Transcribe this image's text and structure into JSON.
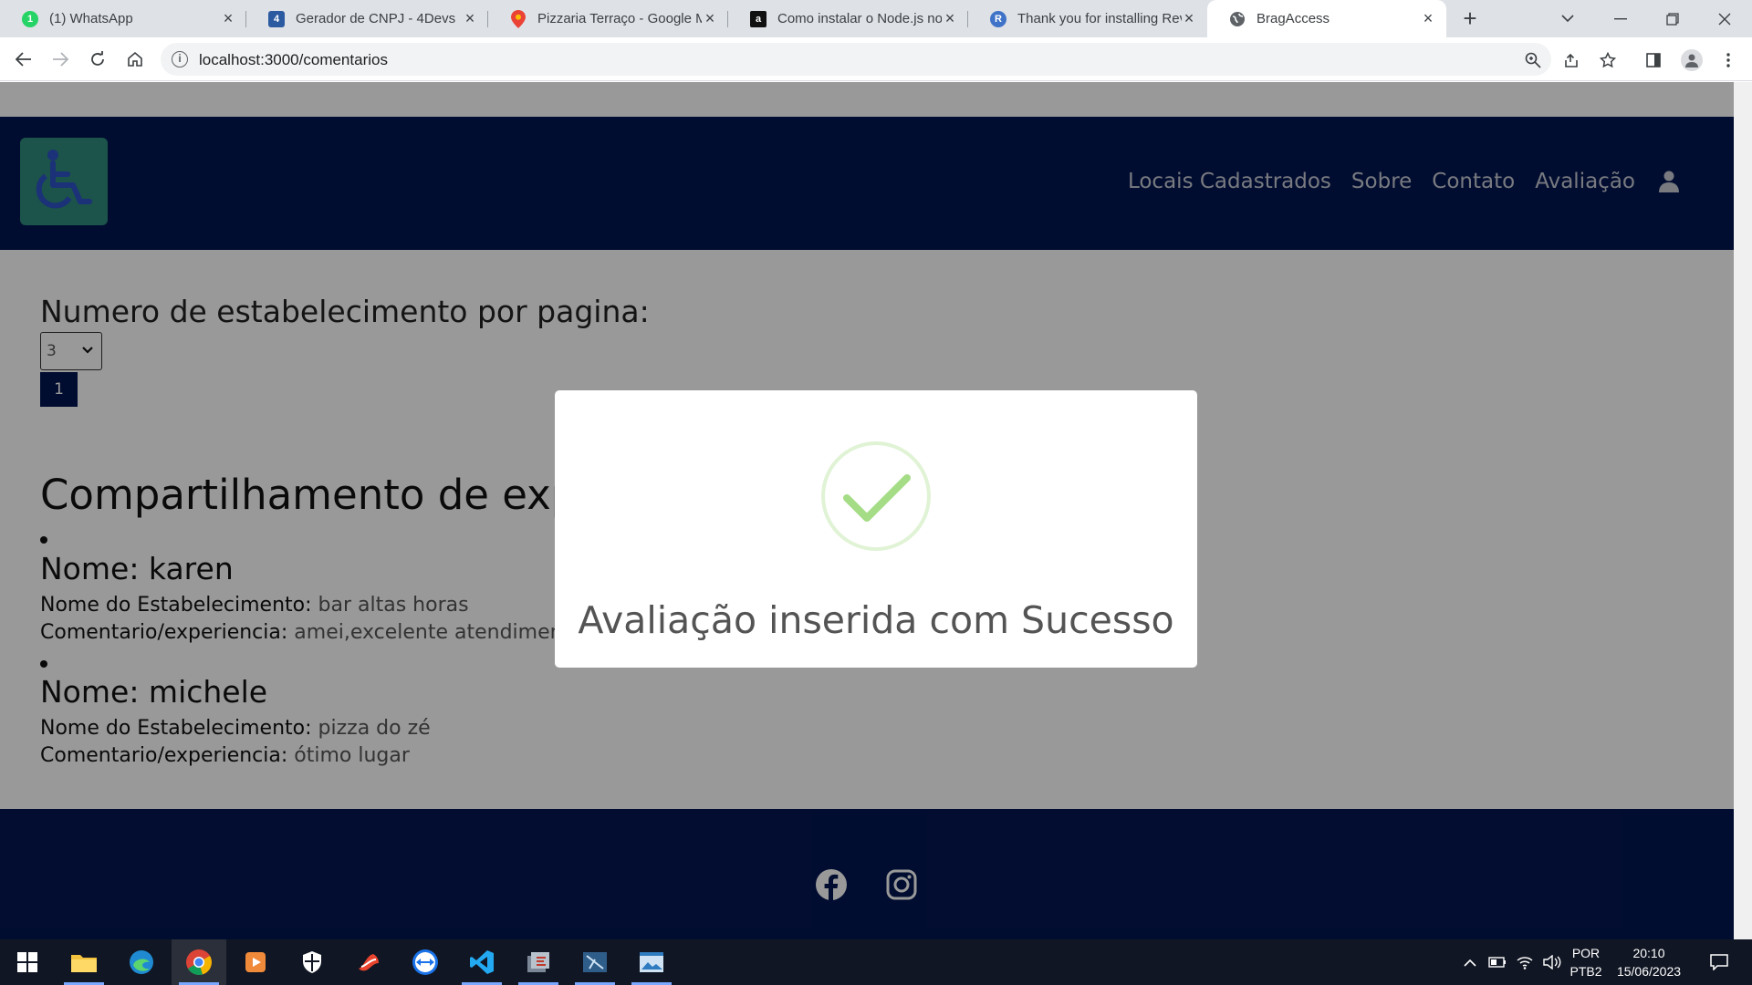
{
  "browser": {
    "tabs": [
      {
        "title": "(1) WhatsApp",
        "icon": "whatsapp-icon",
        "color": "#25d366"
      },
      {
        "title": "Gerador de CNPJ - 4Devs",
        "icon": "4devs-icon",
        "color": "#2c5aa0"
      },
      {
        "title": "Pizzaria Terraço - Google M",
        "icon": "google-maps-icon",
        "color": "#ea4335"
      },
      {
        "title": "Como instalar o Node.js no",
        "icon": "a-icon",
        "color": "#111111"
      },
      {
        "title": "Thank you for installing Rev",
        "icon": "r-icon",
        "color": "#3f73c8"
      },
      {
        "title": "BragAccess",
        "icon": "globe-icon",
        "color": "#5f6368"
      }
    ],
    "url": "localhost:3000/comentarios"
  },
  "site": {
    "nav": [
      "Locais Cadastrados",
      "Sobre",
      "Contato",
      "Avaliação"
    ],
    "per_page_label": "Numero de estabelecimento por pagina:",
    "per_page_value": "3",
    "page_button": "1",
    "section_title": "Compartilhamento de experiências",
    "comments": [
      {
        "name": "Nome: karen",
        "estab_label": "Nome do Estabelecimento:",
        "estab": "bar altas horas",
        "comment_label": "Comentario/experiencia:",
        "comment": "amei,excelente atendimento"
      },
      {
        "name": "Nome: michele",
        "estab_label": "Nome do Estabelecimento:",
        "estab": "pizza do zé",
        "comment_label": "Comentario/experiencia:",
        "comment": "ótimo lugar"
      }
    ]
  },
  "modal": {
    "title": "Avaliação inserida com Sucesso",
    "accent": "#a5dc86"
  },
  "taskbar": {
    "lang": "POR",
    "layout": "PTB2",
    "time": "20:10",
    "date": "15/06/2023"
  },
  "colors": {
    "nav_bg": "#031651",
    "logo_bg": "#2f8a7c"
  }
}
